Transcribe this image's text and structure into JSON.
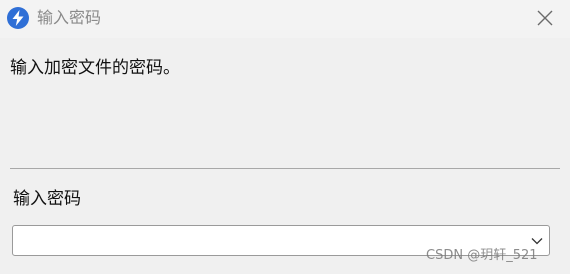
{
  "window": {
    "title": "输入密码",
    "app_icon": "blue-lightning-icon",
    "close_icon": "close-icon"
  },
  "dialog": {
    "message": "输入加密文件的密码。",
    "password_label": "输入密码",
    "password_value": "",
    "dropdown_icon": "chevron-down-icon"
  },
  "watermark": {
    "text": "CSDN @玥轩_521"
  },
  "colors": {
    "app_icon_bg": "#2f6fd6",
    "window_bg": "#f0f0f0",
    "title_text": "#8a8a8a",
    "divider": "#a8a8a8"
  }
}
